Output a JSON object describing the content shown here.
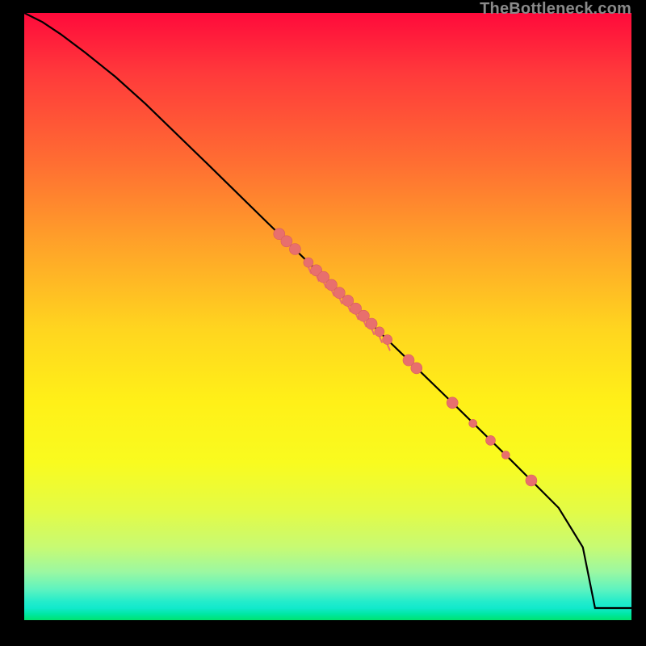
{
  "watermark": "TheBottleneck.com",
  "colors": {
    "background": "#000000",
    "curve": "#000000",
    "dot_fill": "#e86f6d",
    "dot_stroke": "#d85f5d"
  },
  "chart_data": {
    "type": "line",
    "title": "",
    "xlabel": "",
    "ylabel": "",
    "xlim": [
      0,
      100
    ],
    "ylim": [
      0,
      100
    ],
    "curve": {
      "x": [
        0,
        3,
        6,
        10,
        15,
        20,
        30,
        40,
        50,
        60,
        70,
        80,
        88,
        92,
        94,
        100
      ],
      "y": [
        100,
        98.5,
        96.5,
        93.5,
        89.5,
        85,
        75.3,
        65.5,
        55.8,
        46,
        36.3,
        26.5,
        18.5,
        12,
        2,
        2
      ]
    },
    "series": [
      {
        "name": "markers",
        "points": [
          {
            "x": 42.0,
            "y": 63.6,
            "r": 7
          },
          {
            "x": 43.2,
            "y": 62.4,
            "r": 7
          },
          {
            "x": 44.6,
            "y": 61.1,
            "r": 7
          },
          {
            "x": 46.8,
            "y": 58.9,
            "r": 6
          },
          {
            "x": 48.1,
            "y": 57.6,
            "r": 7
          },
          {
            "x": 49.3,
            "y": 56.5,
            "r": 7
          },
          {
            "x": 50.6,
            "y": 55.2,
            "r": 7
          },
          {
            "x": 51.9,
            "y": 53.9,
            "r": 7
          },
          {
            "x": 53.3,
            "y": 52.6,
            "r": 7
          },
          {
            "x": 54.6,
            "y": 51.3,
            "r": 7
          },
          {
            "x": 55.9,
            "y": 50.1,
            "r": 7
          },
          {
            "x": 57.2,
            "y": 48.8,
            "r": 7
          },
          {
            "x": 58.5,
            "y": 47.5,
            "r": 6
          },
          {
            "x": 59.8,
            "y": 46.2,
            "r": 6
          },
          {
            "x": 63.3,
            "y": 42.8,
            "r": 7
          },
          {
            "x": 64.6,
            "y": 41.5,
            "r": 7
          },
          {
            "x": 70.5,
            "y": 35.8,
            "r": 7
          },
          {
            "x": 73.9,
            "y": 32.4,
            "r": 5
          },
          {
            "x": 76.8,
            "y": 29.6,
            "r": 6
          },
          {
            "x": 79.3,
            "y": 27.2,
            "r": 5
          },
          {
            "x": 83.5,
            "y": 23.0,
            "r": 7
          }
        ]
      }
    ],
    "annotations": []
  }
}
